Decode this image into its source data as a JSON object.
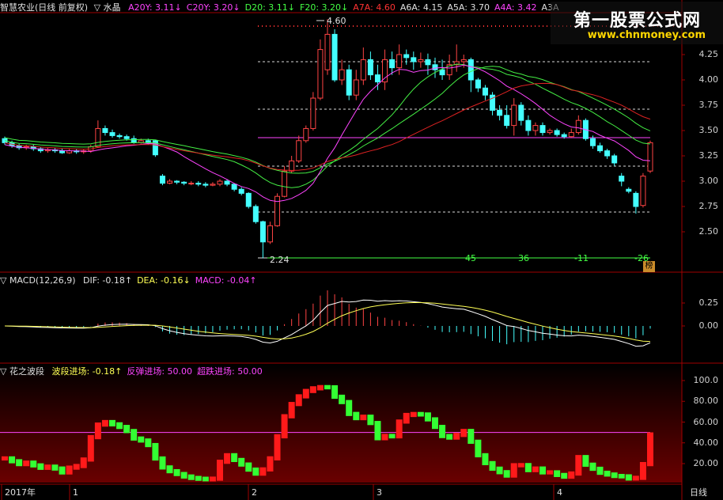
{
  "main_header": {
    "title": "智慧农业(日线 前复权)",
    "indicator": "▽ 水晶",
    "items": [
      {
        "text": "A20Y: 3.11↓",
        "color": "#ff44ff"
      },
      {
        "text": "C20Y: 3.20↓",
        "color": "#ff44ff"
      },
      {
        "text": "D20: 3.11↓",
        "color": "#44ff44"
      },
      {
        "text": "F20: 3.20↓",
        "color": "#44ff44"
      },
      {
        "text": "A7A: 4.60",
        "color": "#ff3333"
      },
      {
        "text": "A6A: 4.15",
        "color": "#e0e0e0"
      },
      {
        "text": "A5A: 3.70",
        "color": "#e0e0e0"
      },
      {
        "text": "A4A: 3.42",
        "color": "#ff44ff"
      },
      {
        "text": "A3A",
        "color": "#e0e0e0"
      }
    ]
  },
  "macd_header": {
    "title": "▽ MACD(12,26,9)",
    "items": [
      {
        "text": "DIF: -0.18↑",
        "color": "#e0e0e0"
      },
      {
        "text": "DEA: -0.16↓",
        "color": "#ffff55"
      },
      {
        "text": "MACD: -0.04↑",
        "color": "#ff44ff"
      }
    ]
  },
  "wave_header": {
    "title": "▽ 花之波段",
    "items": [
      {
        "text": "波段进场: -0.18↑",
        "color": "#ffff55"
      },
      {
        "text": "反弹进场: 50.00",
        "color": "#ff44ff"
      },
      {
        "text": "超跌进场: 50.00",
        "color": "#ff44ff"
      }
    ]
  },
  "main_axis": [
    "4.25",
    "4.00",
    "3.75",
    "3.50",
    "3.25",
    "3.00",
    "2.75",
    "2.50"
  ],
  "macd_axis": [
    "0.25",
    "0.00"
  ],
  "wave_axis": [
    "100.0",
    "80.00",
    "60.00",
    "40.00",
    "20.00"
  ],
  "annotations": {
    "high": "4.60",
    "low": "2.24",
    "counts": [
      "45",
      "36",
      "-11",
      "-26"
    ],
    "badge": "榜"
  },
  "date_axis": {
    "labels": [
      "2017年",
      "1",
      "2",
      "3",
      "4"
    ],
    "period": "日线"
  },
  "watermark": {
    "line1": "第一股票公式网",
    "line2": "www.chnmoney.com"
  },
  "colors": {
    "up": "#ff4444",
    "down": "#44ffff",
    "wave_up": "#ff1a1a",
    "wave_down": "#33ff33",
    "ma_green": "#44ee44",
    "ma_magenta": "#ff44ff",
    "ma_red": "#dd2222",
    "dif": "#ffffff",
    "dea": "#ffff55"
  },
  "candles": [
    [
      3.42,
      3.38,
      3.44,
      3.36
    ],
    [
      3.38,
      3.35,
      3.4,
      3.33
    ],
    [
      3.35,
      3.33,
      3.37,
      3.31
    ],
    [
      3.33,
      3.34,
      3.36,
      3.31
    ],
    [
      3.34,
      3.32,
      3.36,
      3.3
    ],
    [
      3.32,
      3.3,
      3.34,
      3.28
    ],
    [
      3.3,
      3.31,
      3.33,
      3.28
    ],
    [
      3.31,
      3.3,
      3.33,
      3.28
    ],
    [
      3.3,
      3.28,
      3.32,
      3.27
    ],
    [
      3.28,
      3.3,
      3.32,
      3.27
    ],
    [
      3.3,
      3.29,
      3.32,
      3.27
    ],
    [
      3.29,
      3.3,
      3.32,
      3.27
    ],
    [
      3.3,
      3.34,
      3.36,
      3.28
    ],
    [
      3.34,
      3.52,
      3.6,
      3.33
    ],
    [
      3.52,
      3.48,
      3.55,
      3.45
    ],
    [
      3.48,
      3.45,
      3.51,
      3.43
    ],
    [
      3.45,
      3.44,
      3.47,
      3.42
    ],
    [
      3.44,
      3.42,
      3.46,
      3.4
    ],
    [
      3.42,
      3.38,
      3.45,
      3.37
    ],
    [
      3.38,
      3.4,
      3.42,
      3.37
    ],
    [
      3.4,
      3.38,
      3.42,
      3.36
    ],
    [
      3.4,
      3.26,
      3.41,
      3.24
    ],
    [
      3.05,
      2.98,
      3.07,
      2.96
    ],
    [
      2.98,
      3.0,
      3.02,
      2.97
    ],
    [
      3.0,
      2.99,
      3.01,
      2.97
    ],
    [
      2.99,
      2.98,
      3.0,
      2.96
    ],
    [
      2.98,
      2.98,
      3.0,
      2.96
    ],
    [
      2.98,
      2.97,
      3.0,
      2.95
    ],
    [
      2.97,
      2.96,
      2.99,
      2.94
    ],
    [
      2.96,
      2.97,
      2.99,
      2.95
    ],
    [
      2.97,
      3.0,
      3.02,
      2.95
    ],
    [
      3.0,
      2.97,
      3.02,
      2.95
    ],
    [
      2.97,
      2.92,
      2.98,
      2.9
    ],
    [
      2.92,
      2.88,
      2.94,
      2.86
    ],
    [
      2.88,
      2.75,
      2.89,
      2.73
    ],
    [
      2.75,
      2.6,
      2.77,
      2.58
    ],
    [
      2.6,
      2.4,
      2.61,
      2.24
    ],
    [
      2.4,
      2.56,
      2.6,
      2.38
    ],
    [
      2.56,
      2.85,
      2.88,
      2.55
    ],
    [
      2.85,
      3.1,
      3.15,
      2.84
    ],
    [
      3.1,
      3.2,
      3.25,
      3.08
    ],
    [
      3.2,
      3.4,
      3.45,
      3.18
    ],
    [
      3.4,
      3.52,
      3.55,
      3.38
    ],
    [
      3.52,
      3.82,
      3.88,
      3.5
    ],
    [
      3.82,
      4.3,
      4.4,
      3.8
    ],
    [
      4.1,
      4.45,
      4.6,
      4.05
    ],
    [
      4.45,
      4.0,
      4.5,
      3.98
    ],
    [
      4.0,
      4.1,
      4.2,
      3.95
    ],
    [
      4.1,
      3.85,
      4.15,
      3.8
    ],
    [
      3.85,
      4.0,
      4.1,
      3.8
    ],
    [
      4.0,
      4.2,
      4.32,
      3.95
    ],
    [
      4.2,
      4.05,
      4.28,
      4.0
    ],
    [
      4.05,
      3.98,
      4.15,
      3.9
    ],
    [
      3.98,
      4.2,
      4.3,
      3.9
    ],
    [
      4.2,
      4.12,
      4.28,
      4.05
    ],
    [
      4.12,
      4.25,
      4.35,
      4.05
    ],
    [
      4.25,
      4.22,
      4.3,
      4.15
    ],
    [
      4.22,
      4.18,
      4.28,
      4.1
    ],
    [
      4.18,
      4.2,
      4.27,
      4.12
    ],
    [
      4.2,
      4.15,
      4.26,
      4.05
    ],
    [
      4.15,
      4.1,
      4.22,
      4.02
    ],
    [
      4.1,
      4.05,
      4.2,
      4.0
    ],
    [
      4.05,
      4.15,
      4.25,
      4.0
    ],
    [
      4.15,
      4.18,
      4.35,
      4.08
    ],
    [
      4.18,
      4.2,
      4.25,
      4.12
    ],
    [
      4.2,
      4.0,
      4.22,
      3.88
    ],
    [
      4.0,
      3.92,
      4.02,
      3.88
    ],
    [
      3.92,
      3.85,
      3.95,
      3.8
    ],
    [
      3.85,
      3.7,
      3.88,
      3.65
    ],
    [
      3.7,
      3.65,
      3.75,
      3.6
    ],
    [
      3.65,
      3.55,
      3.75,
      3.52
    ],
    [
      3.55,
      3.75,
      3.82,
      3.45
    ],
    [
      3.75,
      3.6,
      3.78,
      3.55
    ],
    [
      3.6,
      3.5,
      3.65,
      3.45
    ],
    [
      3.5,
      3.55,
      3.58,
      3.45
    ],
    [
      3.55,
      3.48,
      3.58,
      3.45
    ],
    [
      3.48,
      3.5,
      3.52,
      3.46
    ],
    [
      3.5,
      3.46,
      3.52,
      3.44
    ],
    [
      3.46,
      3.44,
      3.48,
      3.42
    ],
    [
      3.44,
      3.48,
      3.52,
      3.43
    ],
    [
      3.48,
      3.6,
      3.65,
      3.46
    ],
    [
      3.6,
      3.42,
      3.62,
      3.4
    ],
    [
      3.42,
      3.35,
      3.45,
      3.32
    ],
    [
      3.35,
      3.3,
      3.38,
      3.28
    ],
    [
      3.3,
      3.25,
      3.32,
      3.22
    ],
    [
      3.25,
      3.18,
      3.27,
      3.15
    ],
    [
      3.05,
      3.0,
      3.08,
      2.95
    ],
    [
      2.92,
      2.9,
      2.94,
      2.88
    ],
    [
      2.88,
      2.75,
      2.9,
      2.68
    ],
    [
      2.76,
      3.05,
      3.08,
      2.74
    ],
    [
      3.1,
      3.38,
      3.4,
      3.08
    ]
  ]
}
